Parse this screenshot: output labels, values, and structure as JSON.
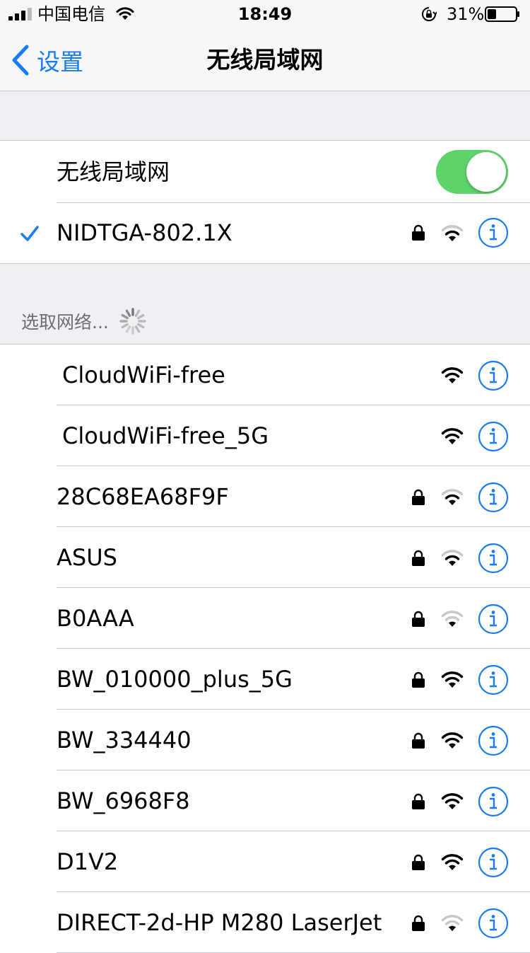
{
  "status_bar": {
    "carrier": "中国电信",
    "time": "18:49",
    "battery_percent": "31%",
    "battery_level": 0.31
  },
  "nav": {
    "back_label": "设置",
    "title": "无线局域网"
  },
  "wifi_toggle": {
    "label": "无线局域网",
    "on": true
  },
  "connected_network": {
    "name": "NIDTGA-802.1X",
    "locked": true,
    "signal_bars": 2
  },
  "choose_network_header": "选取网络...",
  "networks": [
    {
      "name": "CloudWiFi-free",
      "locked": false,
      "signal_bars": 3
    },
    {
      "name": "CloudWiFi-free_5G",
      "locked": false,
      "signal_bars": 3
    },
    {
      "name": "28C68EA68F9F",
      "locked": true,
      "signal_bars": 2
    },
    {
      "name": "ASUS",
      "locked": true,
      "signal_bars": 2
    },
    {
      "name": "B0AAA",
      "locked": true,
      "signal_bars": 1
    },
    {
      "name": "BW_010000_plus_5G",
      "locked": true,
      "signal_bars": 3
    },
    {
      "name": "BW_334440",
      "locked": true,
      "signal_bars": 3
    },
    {
      "name": "BW_6968F8",
      "locked": true,
      "signal_bars": 3
    },
    {
      "name": "D1V2",
      "locked": true,
      "signal_bars": 3
    },
    {
      "name": "DIRECT-2d-HP M280 LaserJet",
      "locked": true,
      "signal_bars": 1
    }
  ],
  "colors": {
    "accent": "#1a7cf5",
    "toggle_on": "#5dd36a",
    "background": "#efeff4",
    "separator": "#c8c7cc",
    "secondary_text": "#6d6d72"
  },
  "icons": [
    "signal-icon",
    "wifi-icon",
    "orientation-lock-icon",
    "battery-icon",
    "chevron-left-icon",
    "checkmark-icon",
    "lock-icon",
    "info-icon",
    "spinner-icon"
  ]
}
